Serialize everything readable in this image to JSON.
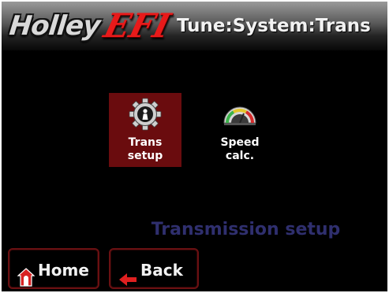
{
  "header": {
    "logo_holley": "Holley",
    "logo_efi": "EFI",
    "title": "Tune:System:Trans"
  },
  "tiles": [
    {
      "line1": "Trans",
      "line2": "setup",
      "icon": "gear-person-icon",
      "selected": true
    },
    {
      "line1": "Speed",
      "line2": "calc.",
      "icon": "speedometer-icon",
      "selected": false
    }
  ],
  "status_text": "Transmission setup",
  "nav": {
    "home_label": "Home",
    "back_label": "Back"
  },
  "colors": {
    "accent_red": "#6a0c0e",
    "status_text": "#2f2f6e",
    "logo_red": "#e81a1a"
  }
}
